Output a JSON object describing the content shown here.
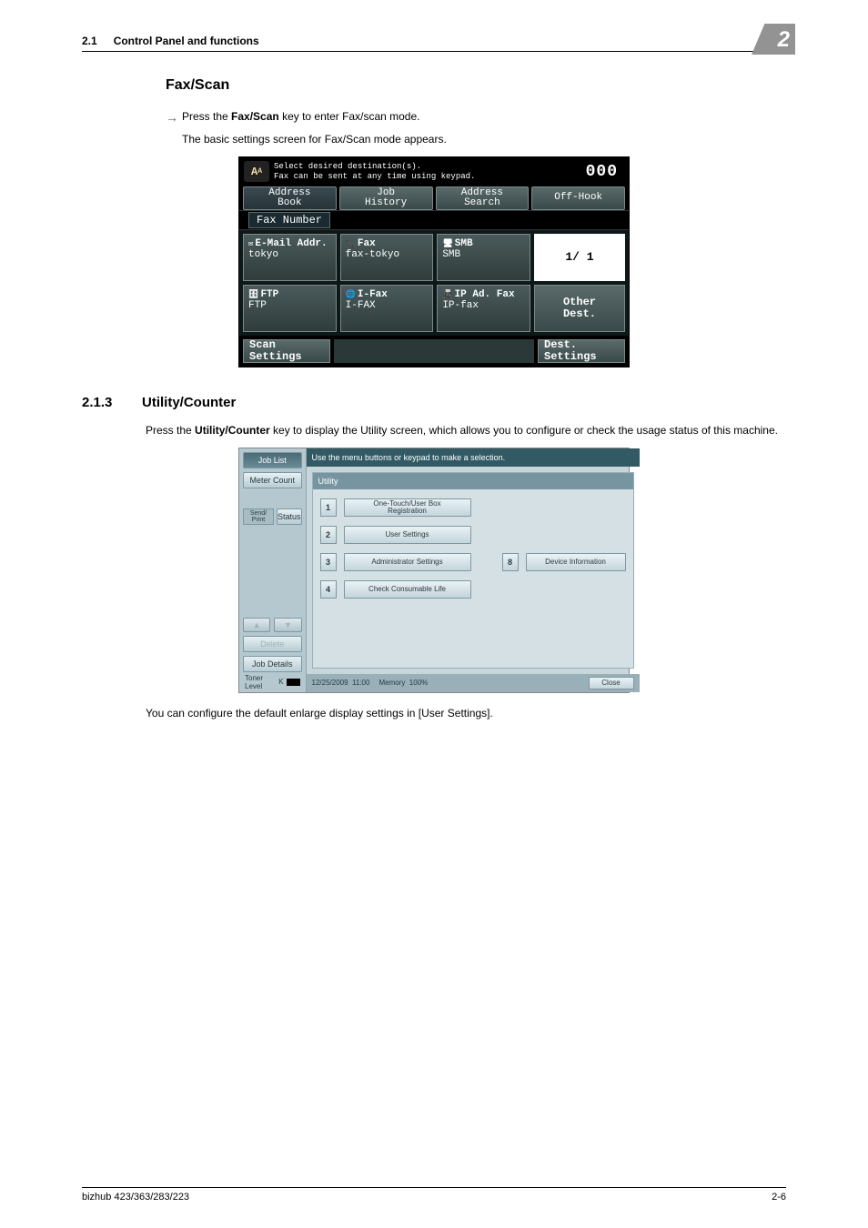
{
  "header": {
    "section_num": "2.1",
    "section_title": "Control Panel and functions",
    "chapter_badge": "2"
  },
  "faxscan": {
    "heading": "Fax/Scan",
    "step_pre": "Press the ",
    "step_key": "Fax/Scan",
    "step_post": " key to enter Fax/scan mode.",
    "sub": "The basic settings screen for Fax/Scan mode appears."
  },
  "shot1": {
    "top_line1": "Select desired destination(s).",
    "top_line2": "Fax can be sent at any time using keypad.",
    "counter": "000",
    "tabs": {
      "address_book": "Address\nBook",
      "job_history": "Job\nHistory",
      "address_search": "Address\nSearch"
    },
    "off_hook": "Off-Hook",
    "fax_number_label": "Fax Number",
    "cells": {
      "email": {
        "l1": "E-Mail Addr.",
        "l2": "tokyo"
      },
      "fax": {
        "l1": "Fax",
        "l2": "fax-tokyo"
      },
      "smb": {
        "l1": "SMB",
        "l2": "SMB"
      },
      "ftp": {
        "l1": "FTP",
        "l2": "FTP"
      },
      "ifax": {
        "l1": "I-Fax",
        "l2": "I-FAX"
      },
      "ipfax": {
        "l1": "IP Ad. Fax",
        "l2": "IP-fax"
      }
    },
    "page_indicator": "1/   1",
    "other_dest_l1": "Other",
    "other_dest_l2": "Dest.",
    "scan_l1": "Scan",
    "scan_l2": "Settings",
    "dest_l1": "Dest.",
    "dest_l2": "Settings"
  },
  "utility": {
    "num": "2.1.3",
    "title": "Utility/Counter",
    "p_pre": "Press the ",
    "p_key": "Utility/Counter",
    "p_post": " key to display the Utility screen, which allows you to configure or check the usage status of this machine.",
    "after": "You can configure the default enlarge display settings in [User Settings]."
  },
  "shot2": {
    "side": {
      "job_list": "Job List",
      "meter_count": "Meter Count",
      "status_small": "Send/\nPrint",
      "status": "Status",
      "delete": "Delete",
      "job_details": "Job Details",
      "toner_label": "Toner Level",
      "toner_k": "K"
    },
    "hint": "Use the menu buttons or keypad to make a selection.",
    "panel_title": "Utility",
    "items": {
      "i1": "One-Touch/User Box\nRegistration",
      "i2": "User Settings",
      "i3": "Administrator Settings",
      "i4": "Check Consumable Life",
      "i8": "Device Information"
    },
    "nums": {
      "n1": "1",
      "n2": "2",
      "n3": "3",
      "n4": "4",
      "n8": "8"
    },
    "foot": {
      "date": "12/25/2009",
      "time": "11:00",
      "mem_lbl": "Memory",
      "mem_val": "100%",
      "close": "Close"
    }
  },
  "footer": {
    "left": "bizhub 423/363/283/223",
    "right": "2-6"
  }
}
